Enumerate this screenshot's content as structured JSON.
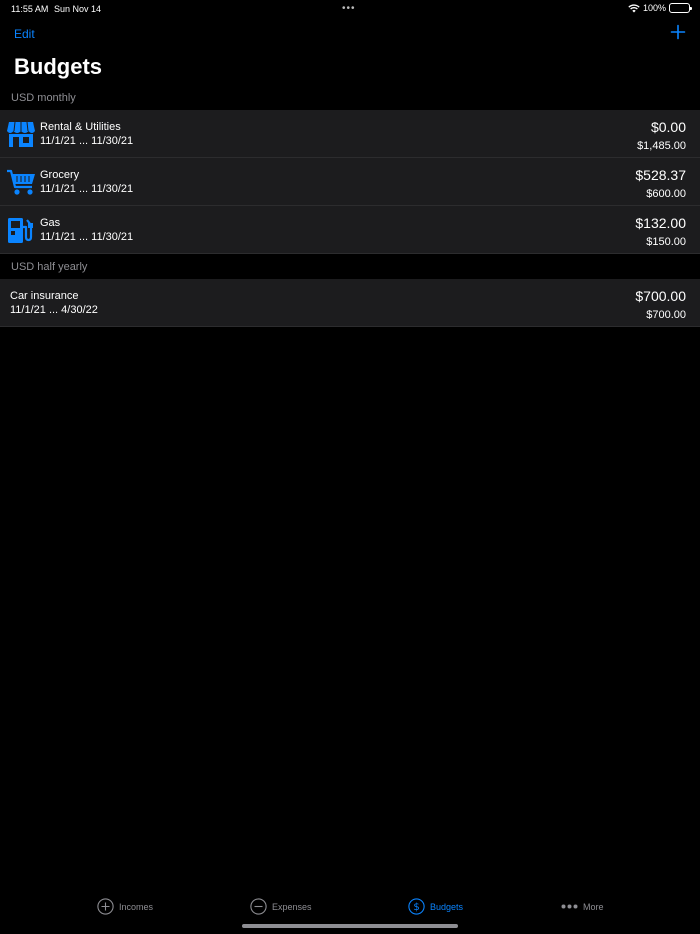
{
  "status_bar": {
    "time": "11:55 AM",
    "date": "Sun Nov 14",
    "battery": "100%"
  },
  "nav": {
    "edit_label": "Edit",
    "title": "Budgets"
  },
  "sections": [
    {
      "header": "USD monthly",
      "rows": [
        {
          "title": "Rental & Utilities",
          "dates": "11/1/21 ... 11/30/21",
          "spent": "$0.00",
          "budget": "$1,485.00",
          "icon": "storefront-icon"
        },
        {
          "title": "Grocery",
          "dates": "11/1/21 ... 11/30/21",
          "spent": "$528.37",
          "budget": "$600.00",
          "icon": "shopping-cart-icon"
        },
        {
          "title": "Gas",
          "dates": "11/1/21 ... 11/30/21",
          "spent": "$132.00",
          "budget": "$150.00",
          "icon": "fuel-pump-icon"
        }
      ]
    },
    {
      "header": "USD half yearly",
      "rows": [
        {
          "title": "Car insurance",
          "dates": "11/1/21 ... 4/30/22",
          "spent": "$700.00",
          "budget": "$700.00"
        }
      ]
    }
  ],
  "tabs": [
    {
      "label": "Incomes",
      "icon": "plus-circle-icon"
    },
    {
      "label": "Expenses",
      "icon": "minus-circle-icon"
    },
    {
      "label": "Budgets",
      "icon": "dollar-circle-icon",
      "active": true
    },
    {
      "label": "More",
      "icon": "more-dots-icon"
    }
  ],
  "colors": {
    "accent": "#0a84ff",
    "background": "#000000",
    "row_background": "#1c1c1e",
    "secondary_text": "#8e8e93"
  }
}
